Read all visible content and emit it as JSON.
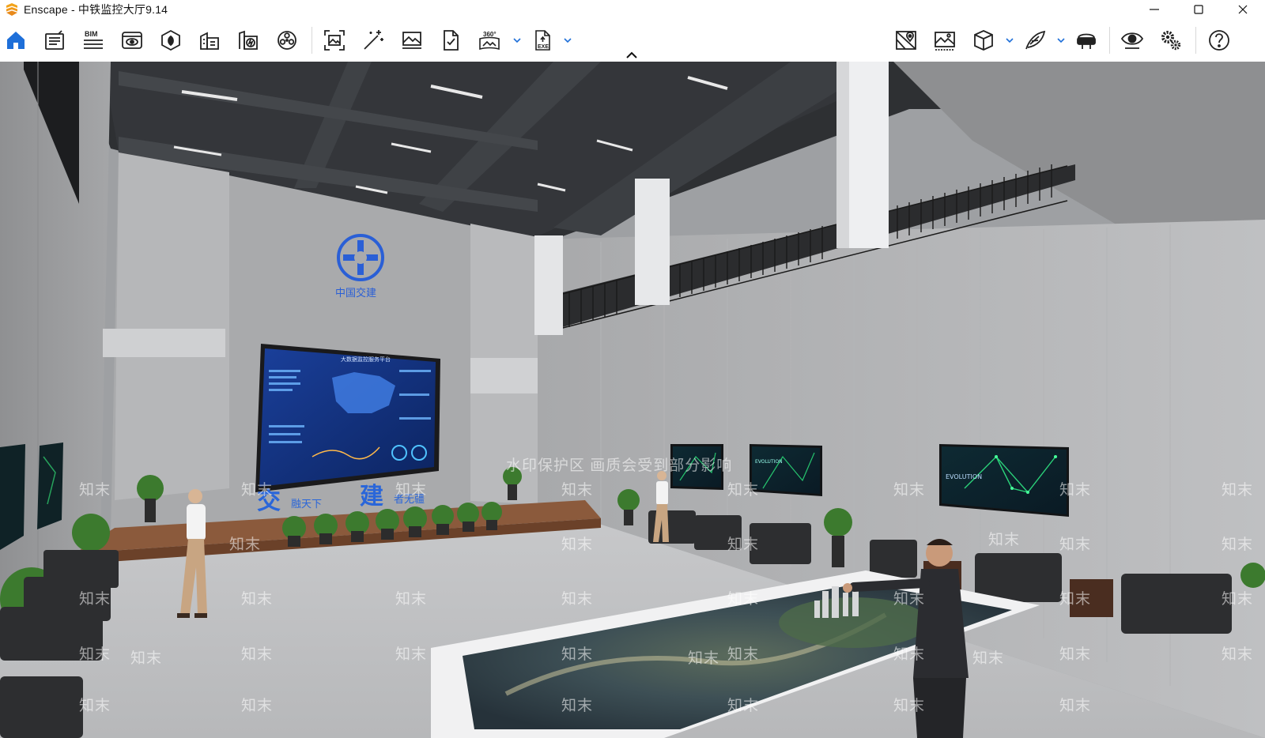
{
  "window": {
    "app_name": "Enscape",
    "title": "Enscape - 中铁监控大厅9.14"
  },
  "toolbar": {
    "left_tools": [
      {
        "name": "home-icon",
        "active": true
      },
      {
        "name": "project-info-icon"
      },
      {
        "name": "bim-icon",
        "label": "BIM"
      },
      {
        "name": "view-management-icon"
      },
      {
        "name": "material-editor-icon"
      },
      {
        "name": "asset-library-icon"
      },
      {
        "name": "atmosphere-icon"
      },
      {
        "name": "visual-settings-icon"
      },
      {
        "name": "capture-screenshot-icon"
      },
      {
        "name": "magic-wand-icon"
      },
      {
        "name": "render-image-icon"
      },
      {
        "name": "export-file-icon"
      },
      {
        "name": "panorama-icon",
        "label": "360°"
      },
      {
        "name": "export-exe-icon",
        "label": "EXE"
      }
    ],
    "right_tools": [
      {
        "name": "map-location-icon"
      },
      {
        "name": "image-gallery-icon"
      },
      {
        "name": "cube-icon"
      },
      {
        "name": "feather-icon"
      },
      {
        "name": "vr-headset-icon"
      },
      {
        "name": "eye-icon"
      },
      {
        "name": "settings-gears-icon"
      },
      {
        "name": "help-icon"
      }
    ],
    "accent_color": "#1e6fd9"
  },
  "viewport": {
    "scene": "rendered 3D interior of a railway monitoring hall",
    "logo_caption": "中国交建",
    "slogan_left": "交",
    "slogan_left_small": "融天下",
    "slogan_right": "建",
    "slogan_right_small": "者无疆",
    "big_screen_title": "大数据监控服务平台",
    "tv_caption": "EVOLUTION",
    "watermark_banner": "水印保护区  画质会受到部分影响",
    "watermark_mark": "知末"
  }
}
